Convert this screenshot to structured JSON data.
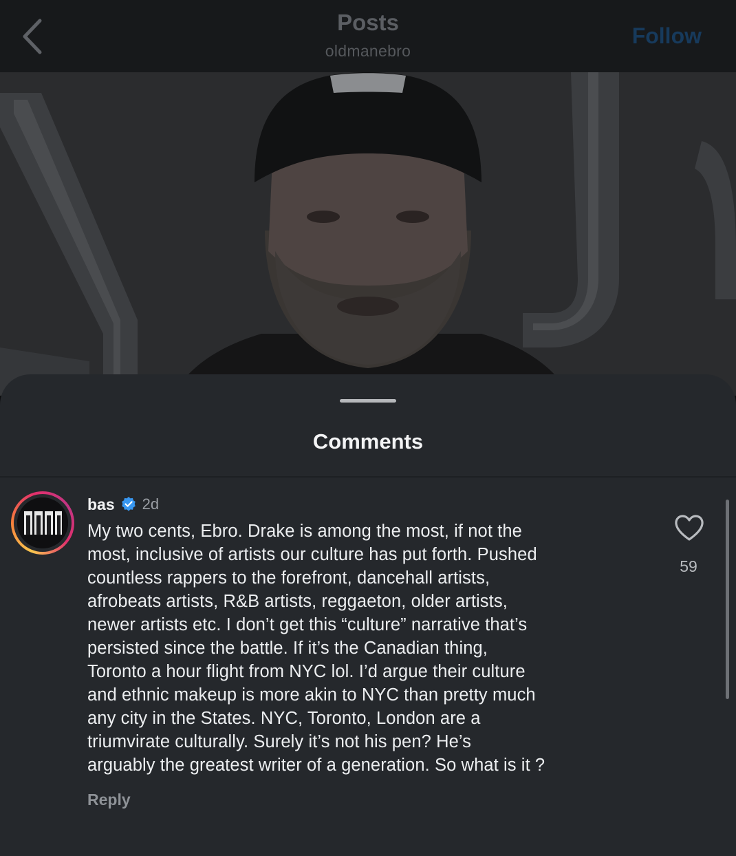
{
  "header": {
    "title": "Posts",
    "subtitle": "oldmanebro",
    "follow_label": "Follow"
  },
  "comments_sheet": {
    "title": "Comments"
  },
  "comment": {
    "username": "bas",
    "timestamp": "2d",
    "text_lines": [
      "My two cents, Ebro. Drake is among the most, if not the",
      "most, inclusive of artists our culture has put forth. Pushed",
      "countless rappers to the forefront, dancehall artists,",
      "afrobeats artists, R&B artists, reggaeton, older artists,",
      "newer artists etc. I don’t get this “culture” narrative that’s",
      "persisted since the battle. If it’s the Canadian thing,",
      "Toronto a hour flight from NYC lol. I’d argue their culture",
      "and ethnic makeup is more akin to NYC than pretty much",
      "any city in the States. NYC, Toronto, London are a",
      "triumvirate culturally. Surely it’s not his  pen? He’s",
      "arguably the greatest writer of a generation. So what is it ?"
    ],
    "reply_label": "Reply",
    "like_count": "59"
  },
  "colors": {
    "follow": "#173a5c",
    "verified": "#3897f0",
    "sheet_bg": "#25282c"
  },
  "icons": {
    "back": "chevron-left-icon",
    "verified": "verified-badge-icon",
    "like": "heart-outline-icon"
  }
}
